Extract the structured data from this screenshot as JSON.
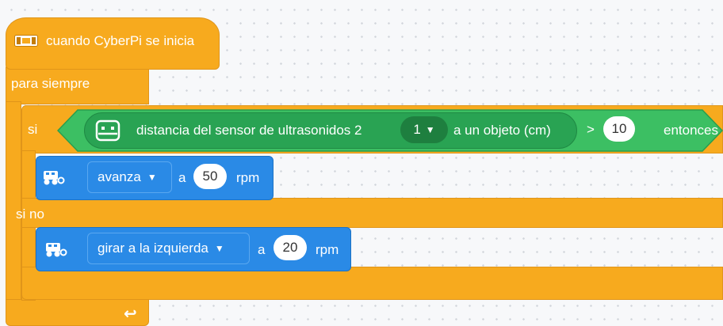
{
  "hat": {
    "label": "cuando CyberPi se inicia",
    "icon": "cyberpi-icon"
  },
  "forever": {
    "label": "para siempre",
    "icon": "loop-arrow-icon",
    "arrow_glyph": "↩"
  },
  "if_else": {
    "if_label": "si",
    "then_label": "entonces",
    "else_label": "si no"
  },
  "condition": {
    "sensor_label": "distancia del sensor de ultrasonidos 2",
    "port_value": "1",
    "unit_label": "a un objeto (cm)",
    "operator": ">",
    "threshold": "10",
    "icon": "ultrasonic-sensor-icon"
  },
  "move_forward": {
    "direction": "avanza",
    "connector": "a",
    "speed": "50",
    "unit": "rpm",
    "icon": "rover-icon"
  },
  "turn_left": {
    "direction": "girar a la izquierda",
    "connector": "a",
    "speed": "20",
    "unit": "rpm",
    "icon": "rover-icon"
  },
  "colors": {
    "event": "#f7aa1e",
    "sensor": "#3cbf63",
    "motion": "#2a8ae6"
  }
}
